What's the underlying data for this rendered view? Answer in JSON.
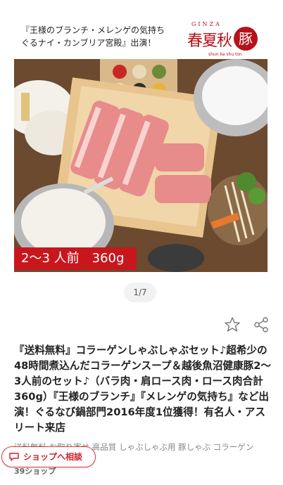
{
  "banner": {
    "line1": "『王様のブランチ・メレンゲの気持ち",
    "line2": "ぐるナイ・カンブリア宮殿』出演！",
    "brand_small": "GINZA",
    "brand_main": "春夏秋",
    "brand_seal": "豚",
    "brand_roman": "shun ka shu ton"
  },
  "price_tag": "2〜3 人前　360g",
  "pager": "1/7",
  "title": "『送料無料』コラーゲンしゃぶしゃぶセット♪超希少の48時間煮込んだコラーゲンスープ＆越後魚沼健康豚2〜3人前のセット♪（バラ肉・肩ロース肉・ロース肉合計360g）『王様のブランチ』『メレンゲの気持ち』など出演！ぐるなび鍋部門2016年度1位獲得！有名人・アスリート来店",
  "tags": "送料無料 お取り寄せ 高品質 しゃぶしゃぶ用 豚しゃぶ コラーゲン",
  "shop_count": "39ショップ",
  "consult_button": "ショップへ相談",
  "colors": {
    "accent": "#c8161d",
    "brand": "#b5121b"
  },
  "icons": {
    "favorite": "star-outline-icon",
    "share": "share-icon",
    "chat": "chat-bubble-icon"
  }
}
